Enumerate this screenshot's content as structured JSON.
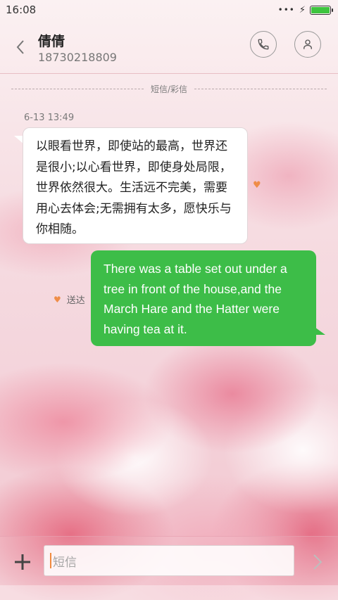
{
  "status_bar": {
    "time": "16:08",
    "dots_icon": "more-dots",
    "charging_icon": "bolt",
    "battery_level": 1.0,
    "battery_color": "#3ec43e"
  },
  "header": {
    "contact_name": "倩倩",
    "contact_number": "18730218809",
    "back_icon": "chevron-left",
    "call_icon": "phone",
    "profile_icon": "person"
  },
  "thread": {
    "message_type_label": "短信/彩信",
    "timestamp": "6-13 13:49",
    "incoming": {
      "text": "以眼看世界，即使站的最高，世界还是很小;以心看世界，即使身处局限，世界依然很大。生活远不完美，需要用心去体会;无需拥有太多，愿快乐与你相随。",
      "bubble_color": "#ffffff"
    },
    "outgoing": {
      "text": "There was a table set out under a tree in front of the house,and the March Hare and the Hatter were having tea at it.",
      "status": "送达",
      "bubble_color": "#3dbd48"
    },
    "accent_color": "#ef8d48"
  },
  "composer": {
    "placeholder": "短信",
    "add_icon": "plus",
    "send_icon": "chevron-right"
  }
}
